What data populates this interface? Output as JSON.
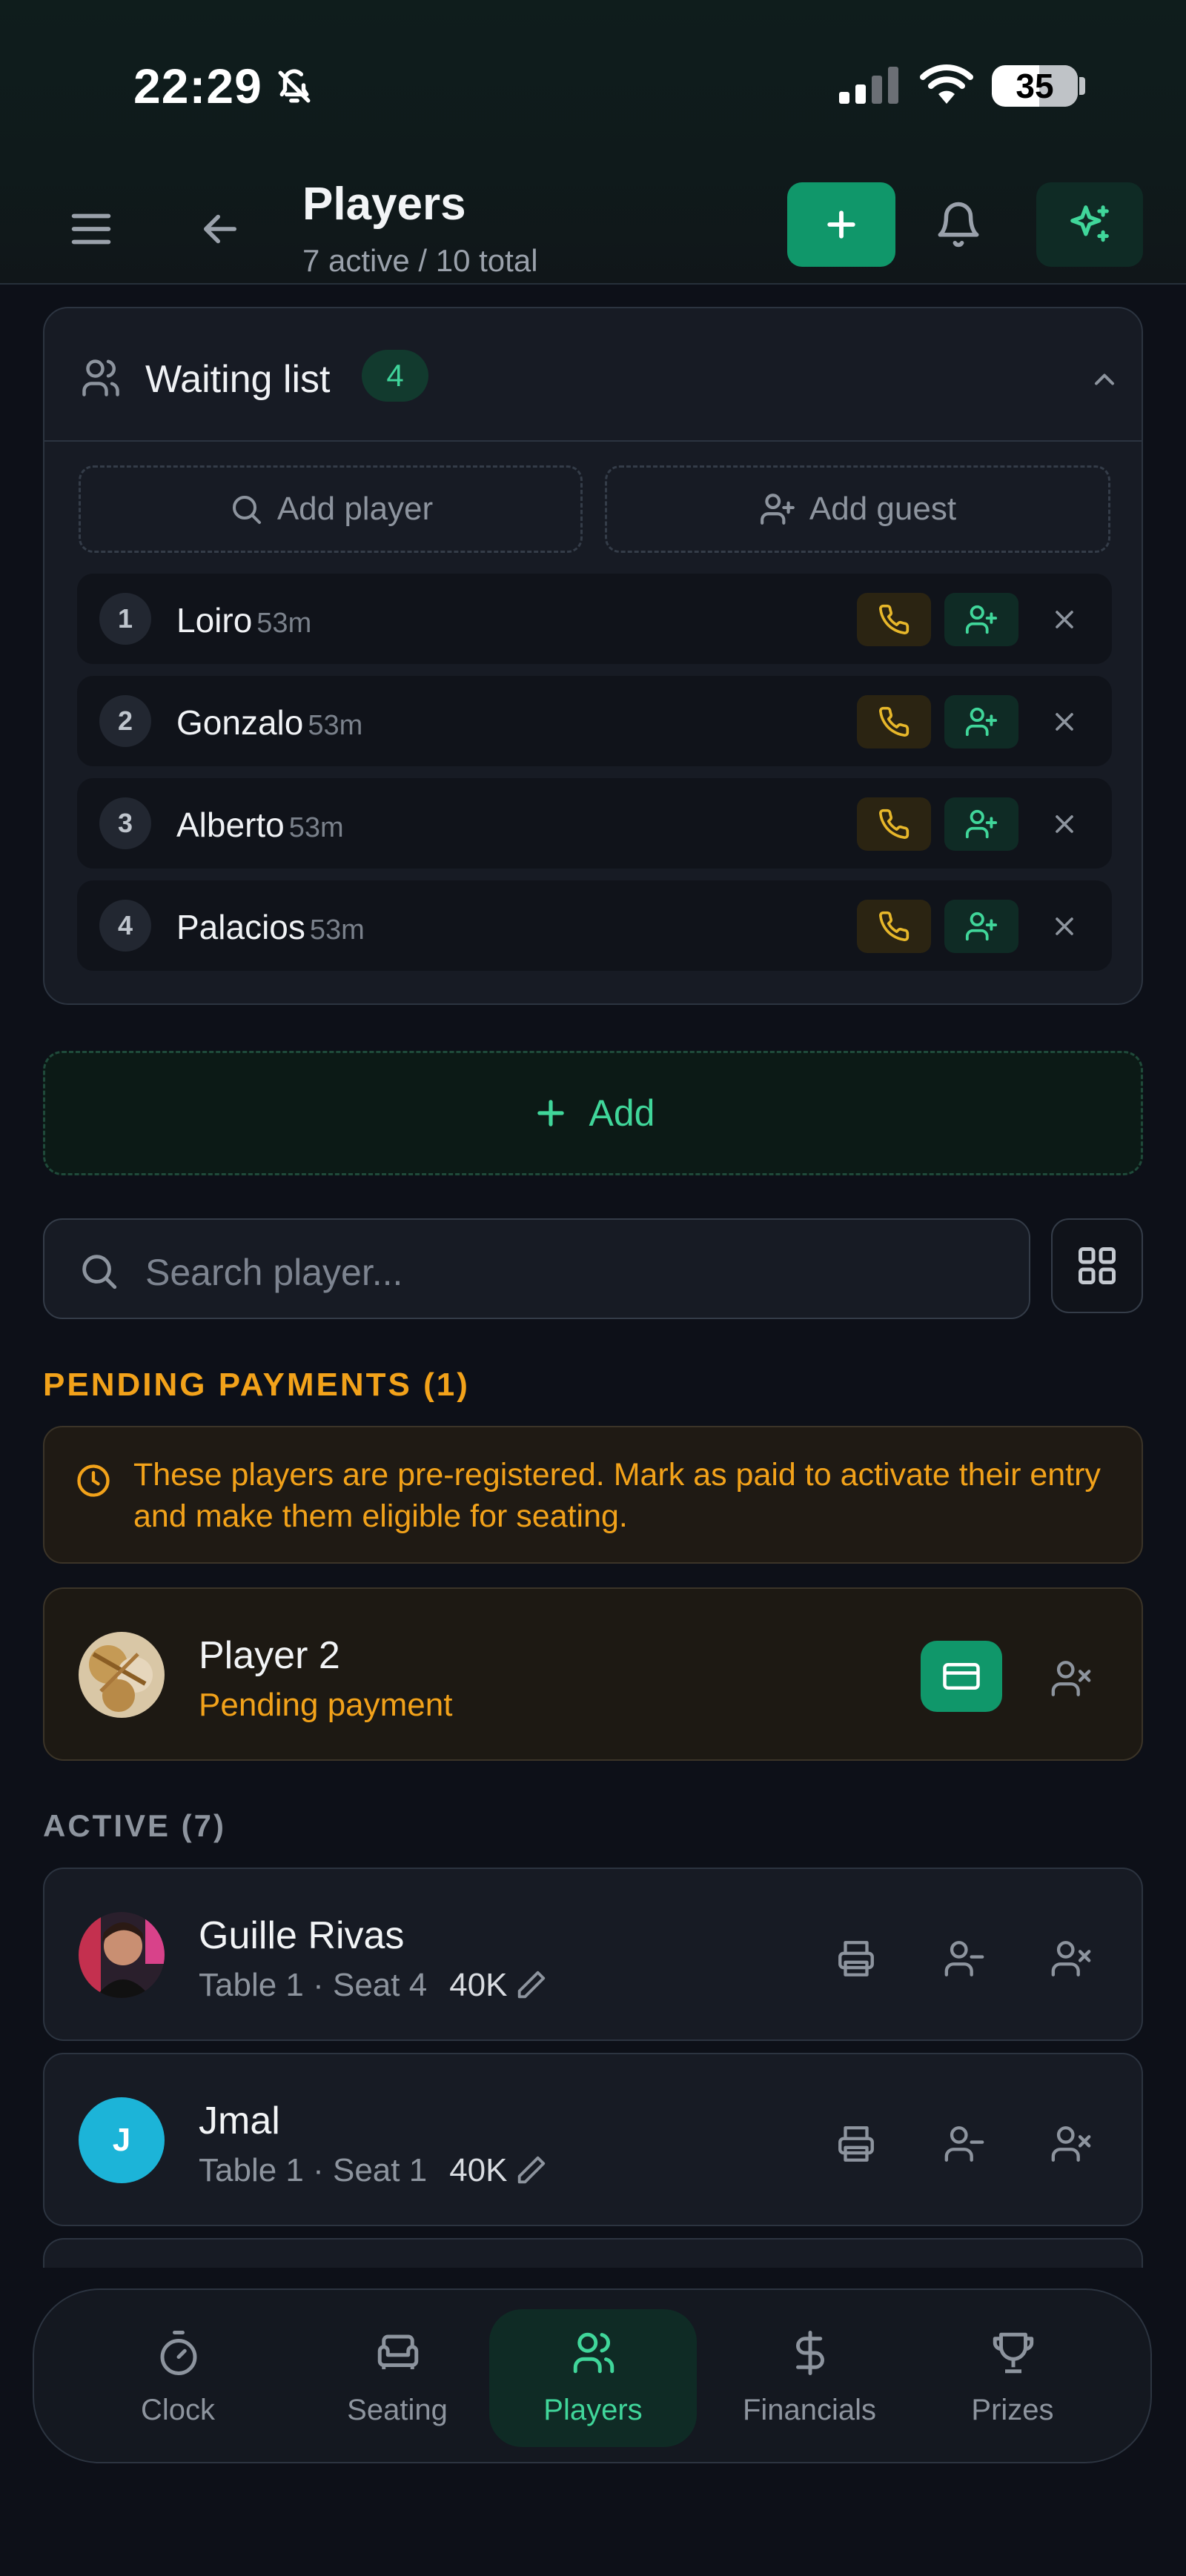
{
  "status": {
    "time": "22:29",
    "battery": "35"
  },
  "header": {
    "title": "Players",
    "subtitle": "7 active / 10 total"
  },
  "waiting_list": {
    "title": "Waiting list",
    "count": "4",
    "add_player": "Add player",
    "add_guest": "Add guest",
    "entries": [
      {
        "num": "1",
        "name": "Loiro",
        "wait": "53m"
      },
      {
        "num": "2",
        "name": "Gonzalo",
        "wait": "53m"
      },
      {
        "num": "3",
        "name": "Alberto",
        "wait": "53m"
      },
      {
        "num": "4",
        "name": "Palacios",
        "wait": "53m"
      }
    ]
  },
  "add_label": "Add",
  "search": {
    "placeholder": "Search player..."
  },
  "pending": {
    "heading": "PENDING PAYMENTS (1)",
    "notice": "These players are pre-registered. Mark as paid to activate their entry and make them eligible for seating.",
    "players": [
      {
        "name": "Player 2",
        "status": "Pending payment"
      }
    ]
  },
  "active": {
    "heading": "ACTIVE (7)",
    "players": [
      {
        "name": "Guille Rivas",
        "seat": "Table 1 · Seat 4",
        "chips": "40K",
        "initial": ""
      },
      {
        "name": "Jmal",
        "seat": "Table 1 · Seat 1",
        "chips": "40K",
        "initial": "J"
      }
    ]
  },
  "nav": {
    "tabs": [
      {
        "label": "Clock",
        "icon": "timer-icon"
      },
      {
        "label": "Seating",
        "icon": "armchair-icon"
      },
      {
        "label": "Players",
        "icon": "users-icon",
        "active": true
      },
      {
        "label": "Financials",
        "icon": "dollar-icon"
      },
      {
        "label": "Prizes",
        "icon": "trophy-icon"
      }
    ]
  },
  "colors": {
    "accent": "#40d69a",
    "primary_button": "#10976a",
    "warning": "#f2a21a",
    "background": "#0d1018"
  }
}
